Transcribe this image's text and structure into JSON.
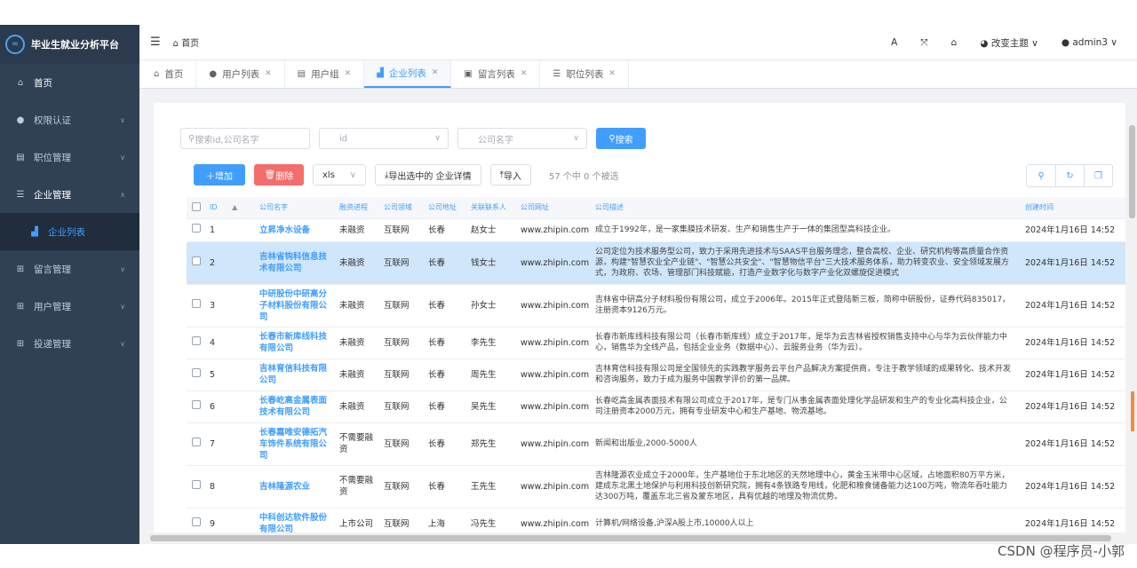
{
  "sidebar": {
    "title": "毕业生就业分析平台",
    "items": [
      {
        "label": "首页",
        "icon": "home-icon"
      },
      {
        "label": "权限认证",
        "icon": "users-icon"
      },
      {
        "label": "职位管理",
        "icon": "briefcase-icon"
      },
      {
        "label": "企业管理",
        "icon": "list-icon"
      },
      {
        "label": "企业列表",
        "icon": "chart-icon"
      },
      {
        "label": "留言管理",
        "icon": "grid-icon"
      },
      {
        "label": "用户管理",
        "icon": "grid-icon"
      },
      {
        "label": "投递管理",
        "icon": "grid-icon"
      }
    ]
  },
  "navbar": {
    "breadcrumb": "首页",
    "font_icon": "A",
    "theme_label": "改变主题",
    "user_label": "admin3"
  },
  "tabs": [
    {
      "label": "首页",
      "closable": false
    },
    {
      "label": "用户列表",
      "closable": true
    },
    {
      "label": "用户组",
      "closable": true
    },
    {
      "label": "企业列表",
      "closable": true,
      "active": true
    },
    {
      "label": "留言列表",
      "closable": true
    },
    {
      "label": "职位列表",
      "closable": true
    }
  ],
  "search": {
    "keyword_placeholder": "搜索id,公司名字",
    "id_placeholder": "id",
    "company_placeholder": "公司名字",
    "search_label": "搜索"
  },
  "toolbar": {
    "add_label": "增加",
    "delete_label": "删除",
    "format_value": "xls",
    "export_label": "导出选中的 企业详情",
    "import_label": "导入",
    "count_text": "57 个中 0 个被选"
  },
  "table": {
    "headers": [
      "ID",
      "公司名字",
      "融资进程",
      "公司领域",
      "公司地址",
      "关联联系人",
      "公司网址",
      "公司描述",
      "创建时间"
    ],
    "rows": [
      {
        "id": "1",
        "name": "立昇净水设备",
        "funding": "未融资",
        "field": "互联网",
        "addr": "长春",
        "contact": "赵女士",
        "url": "www.zhipin.com",
        "desc": "成立于1992年，是一家集膜技术研发、生产和销售生产于一体的集团型高科技企业。",
        "created": "2024年1月16日 14:52"
      },
      {
        "id": "2",
        "name": "吉林省钩科信息技术有限公司",
        "funding": "未融资",
        "field": "互联网",
        "addr": "长春",
        "contact": "钱女士",
        "url": "www.zhipin.com",
        "desc": "公司定位为技术服务型公司，致力于采用先进技术与SAAS平台服务理念，整合高校、企业、研究机构等高质量合作资源，构建\"智慧农业全产业链\"、\"智慧公共安全\"、\"智慧物信平台\"三大技术服务体系，助力转变农业、安全领域发展方式，为政府、农场、管理部门科技赋能，打造产业数字化与数字产业化双螺旋促进模式",
        "created": "2024年1月16日 14:52"
      },
      {
        "id": "3",
        "name": "中研股份中研高分子材料股份有限公司",
        "funding": "未融资",
        "field": "互联网",
        "addr": "长春",
        "contact": "孙女士",
        "url": "www.zhipin.com",
        "desc": "吉林省中研高分子材料股份有限公司，成立于2006年。2015年正式登陆新三板，简称中研股份，证券代码835017，注册资本9126万元。",
        "created": "2024年1月16日 14:52"
      },
      {
        "id": "4",
        "name": "长春市新库线科技有限公司",
        "funding": "未融资",
        "field": "互联网",
        "addr": "长春",
        "contact": "李先生",
        "url": "www.zhipin.com",
        "desc": "长春市新库线科技有限公司（长春市新库线）成立于2017年，是华为云吉林省授权销售支持中心与华为云伙伴能力中心，销售华为全线产品，包括企业业务（数据中心）、云服务业务（华为云）。",
        "created": "2024年1月16日 14:52"
      },
      {
        "id": "5",
        "name": "吉林育信科技有限公司",
        "funding": "未融资",
        "field": "互联网",
        "addr": "长春",
        "contact": "周先生",
        "url": "www.zhipin.com",
        "desc": "吉林育信科技有限公司是全国领先的实践教学服务云平台产品解决方案提供商，专注于教学领域的成果转化、技术开发和咨询服务，致力于成为服务中国教学评价的第一品牌。",
        "created": "2024年1月16日 14:52"
      },
      {
        "id": "6",
        "name": "长春屹高金属表面技术有限公司",
        "funding": "未融资",
        "field": "互联网",
        "addr": "长春",
        "contact": "吴先生",
        "url": "www.zhipin.com",
        "desc": "长春屹高金属表面技术有限公司成立于2017年，是专门从事金属表面处理化学品研发和生产的专业化高科技企业，公司注册资本2000万元，拥有专业研发中心和生产基地、物流基地。",
        "created": "2024年1月16日 14:52"
      },
      {
        "id": "7",
        "name": "长春嘉唯安德拓汽车饰件系统有限公司",
        "funding": "不需要融资",
        "field": "互联网",
        "addr": "长春",
        "contact": "郑先生",
        "url": "www.zhipin.com",
        "desc": "新闻和出版业,2000-5000人",
        "created": "2024年1月16日 14:52"
      },
      {
        "id": "8",
        "name": "吉林隆源农业",
        "funding": "不需要融资",
        "field": "互联网",
        "addr": "长春",
        "contact": "王先生",
        "url": "www.zhipin.com",
        "desc": "吉林隆源农业成立于2000年，生产基地位于东北地区的天然地理中心，黄金玉米带中心区域，占地面积80万平方米，建成东北黑土地保护与利用科技创新研究院，拥有4条铁路专用线，化肥和粮食储备能力达100万吨，物流年吞吐能力达300万吨，覆盖东北三省及蒙东地区，具有优越的地理及物流优势。",
        "created": "2024年1月16日 14:52"
      },
      {
        "id": "9",
        "name": "中科创达软件股份有限公司",
        "funding": "上市公司",
        "field": "互联网",
        "addr": "上海",
        "contact": "冯先生",
        "url": "www.zhipin.com",
        "desc": "计算机/网络设备,沪深A股上市,10000人以上",
        "created": "2024年1月16日 14:52"
      }
    ]
  },
  "watermark": "CSDN @程序员-小郭"
}
